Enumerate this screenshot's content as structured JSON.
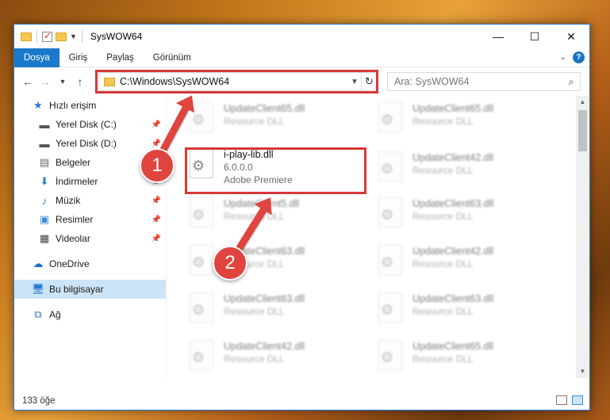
{
  "window": {
    "title": "SysWOW64"
  },
  "ribbon": {
    "tabs": [
      "Dosya",
      "Giriş",
      "Paylaş",
      "Görünüm"
    ]
  },
  "address": {
    "path": "C:\\Windows\\SysWOW64"
  },
  "search": {
    "placeholder": "Ara: SysWOW64"
  },
  "sidebar": {
    "items": [
      {
        "label": "Hızlı erişim",
        "icon": "star-icon"
      },
      {
        "label": "Yerel Disk (C:)",
        "icon": "drive-icon"
      },
      {
        "label": "Yerel Disk (D:)",
        "icon": "drive-icon"
      },
      {
        "label": "Belgeler",
        "icon": "documents-icon"
      },
      {
        "label": "İndirmeler",
        "icon": "download-icon"
      },
      {
        "label": "Müzik",
        "icon": "music-icon"
      },
      {
        "label": "Resimler",
        "icon": "pictures-icon"
      },
      {
        "label": "Videolar",
        "icon": "videos-icon"
      },
      {
        "label": "OneDrive",
        "icon": "cloud-icon"
      },
      {
        "label": "Bu bilgisayar",
        "icon": "computer-icon"
      },
      {
        "label": "Ağ",
        "icon": "network-icon"
      }
    ]
  },
  "files": [
    {
      "name": "UpdateClient65.dll",
      "sub": "Resource DLL"
    },
    {
      "name": "UpdateClient65.dll",
      "sub": "Resource DLL"
    },
    {
      "name": "i-play-lib.dll",
      "version": "6.0.0.0",
      "sub": "Adobe Premiere"
    },
    {
      "name": "UpdateClient42.dll",
      "sub": "Resource DLL"
    },
    {
      "name": "UpdateClient5.dll",
      "sub": "Resource DLL"
    },
    {
      "name": "UpdateClient63.dll",
      "sub": "Resource DLL"
    },
    {
      "name": "UpdateClient63.dll",
      "sub": "Resource DLL"
    },
    {
      "name": "UpdateClient42.dll",
      "sub": "Resource DLL"
    },
    {
      "name": "UpdateClient63.dll",
      "sub": "Resource DLL"
    },
    {
      "name": "UpdateClient63.dll",
      "sub": "Resource DLL"
    },
    {
      "name": "UpdateClient42.dll",
      "sub": "Resource DLL"
    },
    {
      "name": "UpdateClient65.dll",
      "sub": "Resource DLL"
    }
  ],
  "status": {
    "count": "133 öğe"
  },
  "annotations": {
    "step1": "1",
    "step2": "2",
    "color": "#e0443e"
  }
}
